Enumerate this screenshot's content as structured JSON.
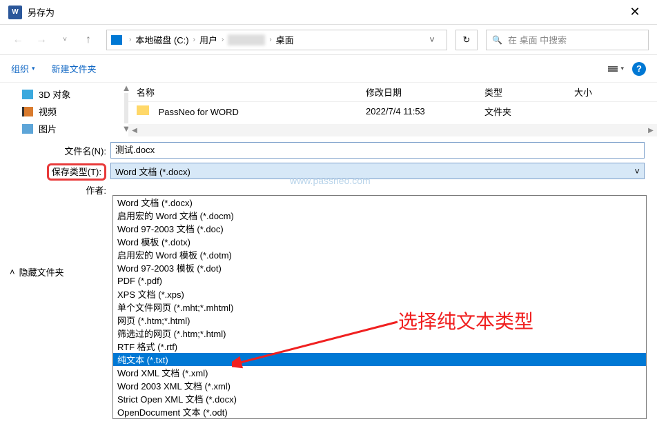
{
  "titlebar": {
    "word_icon": "W",
    "title": "另存为",
    "close": "✕"
  },
  "nav": {
    "back": "←",
    "forward": "→",
    "up_dd": "˅",
    "up": "↑",
    "sep": "›",
    "crumbs": {
      "drive": "本地磁盘 (C:)",
      "users": "用户",
      "desktop": "桌面"
    },
    "dropdown": "˅",
    "refresh": "↻",
    "search_placeholder": "在 桌面 中搜索",
    "search_icon": "🔍"
  },
  "toolbar": {
    "organize": "组织",
    "organize_dd": "▾",
    "newfolder": "新建文件夹",
    "view_dd": "▾",
    "help": "?"
  },
  "sidebar": {
    "items": [
      {
        "label": "3D 对象"
      },
      {
        "label": "视频"
      },
      {
        "label": "图片"
      }
    ]
  },
  "list": {
    "headers": {
      "name": "名称",
      "date": "修改日期",
      "type": "类型",
      "size": "大小"
    },
    "rows": [
      {
        "name": "PassNeo for WORD",
        "date": "2022/7/4 11:53",
        "type": "文件夹",
        "size": ""
      }
    ]
  },
  "form": {
    "filename_label": "文件名(N):",
    "filename_value": "测试.docx",
    "savetype_label": "保存类型(T):",
    "savetype_value": "Word 文档 (*.docx)",
    "savetype_dd": "˅",
    "author_label": "作者:"
  },
  "dropdown_options": [
    "Word 文档 (*.docx)",
    "启用宏的 Word 文档 (*.docm)",
    "Word 97-2003 文档 (*.doc)",
    "Word 模板 (*.dotx)",
    "启用宏的 Word 模板 (*.dotm)",
    "Word 97-2003 模板 (*.dot)",
    "PDF (*.pdf)",
    "XPS 文档 (*.xps)",
    "单个文件网页 (*.mht;*.mhtml)",
    "网页 (*.htm;*.html)",
    "筛选过的网页 (*.htm;*.html)",
    "RTF 格式 (*.rtf)",
    "纯文本 (*.txt)",
    "Word XML 文档 (*.xml)",
    "Word 2003 XML 文档 (*.xml)",
    "Strict Open XML 文档 (*.docx)",
    "OpenDocument 文本 (*.odt)"
  ],
  "selected_option_index": 12,
  "hide_folders": {
    "arrow": "˄",
    "label": "隐藏文件夹"
  },
  "watermark": "www.passneo.com",
  "annotation": "选择纯文本类型"
}
